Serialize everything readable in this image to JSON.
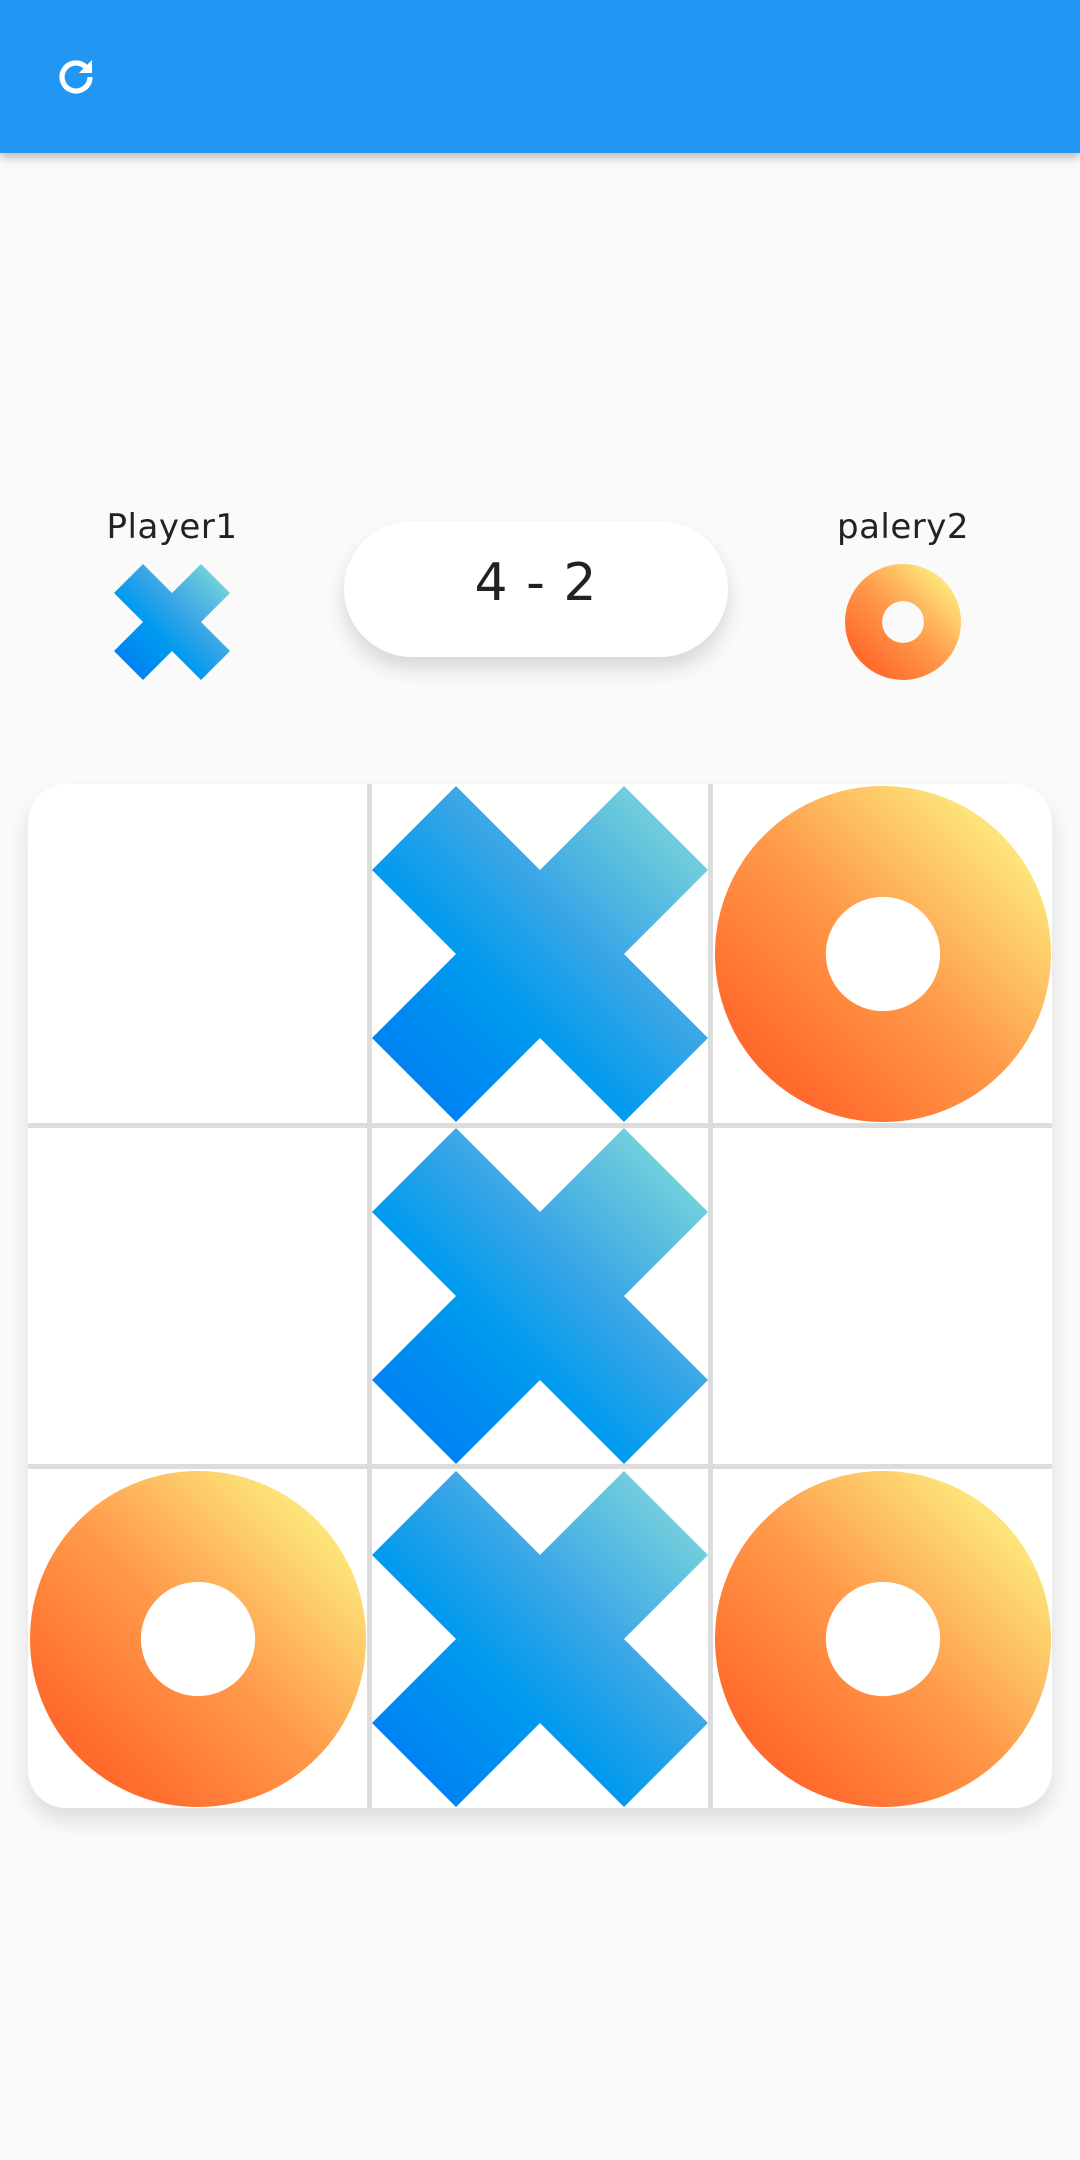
{
  "app_bar": {
    "color": "#2196f3",
    "refresh_icon": "refresh-icon"
  },
  "players": [
    {
      "name": "Player1",
      "mark": "X"
    },
    {
      "name": "palery2",
      "mark": "O"
    }
  ],
  "score": {
    "text": "4 - 2",
    "player1": 4,
    "player2": 2
  },
  "board": {
    "cells": [
      "",
      "X",
      "O",
      "",
      "X",
      "",
      "O",
      "X",
      "O"
    ]
  },
  "colors": {
    "x_gradient": [
      "#8ae0d6",
      "#009aee",
      "#0077f5"
    ],
    "o_gradient": [
      "#fde379",
      "#ff7433"
    ],
    "grid_line": "#dcdcdc",
    "background": "#fafafa"
  }
}
